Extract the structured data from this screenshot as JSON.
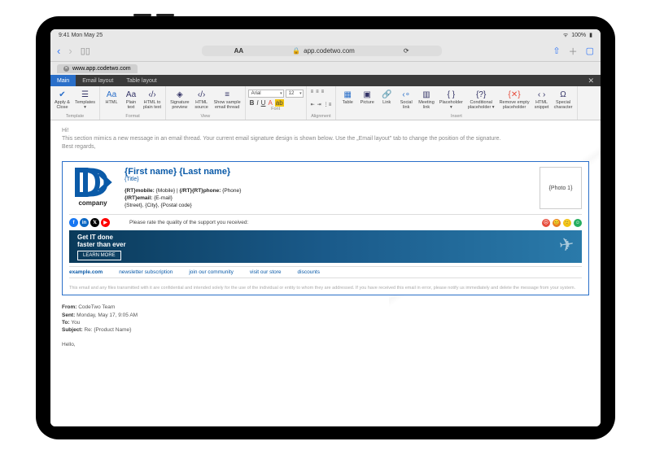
{
  "status": {
    "time": "9:41 Mon May 25",
    "battery": "100%"
  },
  "browser": {
    "aa": "AA",
    "lock": "🔒",
    "url": "app.codetwo.com",
    "tab_url": "www.app.codetwo.com"
  },
  "ribbon": {
    "tabs": [
      "Main",
      "Email layout",
      "Table layout"
    ],
    "groups": {
      "template": {
        "label": "Template",
        "apply_close": "Apply &\nClose",
        "templates": "Templates\n▾"
      },
      "format": {
        "label": "Format",
        "html": "HTML",
        "plain": "Plain\ntext",
        "html2plain": "HTML to\nplain text"
      },
      "view": {
        "label": "View",
        "sig_preview": "Signature\npreview",
        "html_src": "HTML\nsource",
        "sample": "Show sample\nemail thread"
      },
      "font": {
        "label": "Font",
        "name": "Arial",
        "size": "12"
      },
      "alignment": {
        "label": "Alignment"
      },
      "insert": {
        "label": "Insert",
        "table": "Table",
        "picture": "Picture",
        "link": "Link",
        "social": "Social\nlink",
        "meeting": "Meeting\nlink",
        "placeholder": "Placeholder\n▾",
        "cond": "Conditional\nplaceholder ▾",
        "remove": "Remove empty\nplaceholder",
        "snippet": "HTML\nsnippet",
        "special": "Special\ncharacter"
      }
    }
  },
  "content": {
    "greeting": "Hi!",
    "intro": "This section mimics a new message in an email thread. Your current email signature design is shown below. Use the „Email layout\" tab to change the position of the signature.",
    "regards": "Best regards,"
  },
  "signature": {
    "logo_text": "company",
    "name": "{First name} {Last name}",
    "title": "{Title}",
    "contact_line1_a": "{RT}mobile:",
    "contact_line1_b": " {Mobile}   |   ",
    "contact_line1_c": "{/RT}{RT}phone:",
    "contact_line1_d": " {Phone}",
    "contact_line2_a": "{/RT}email:",
    "contact_line2_b": " {E-mail}",
    "contact_line3": "{Street}, {City}, {Postal code}",
    "photo": "{Photo 1}",
    "rate_text": "Please rate the quality of the support you received:",
    "banner_line1": "Get IT done",
    "banner_line2": "faster than ever",
    "banner_cta": "LEARN MORE",
    "links": [
      "example.com",
      "newsletter subscription",
      "join our community",
      "visit our store",
      "discounts"
    ],
    "disclaimer": "This email and any files transmitted with it are confidential and intended solely for the use of the individual or entity to whom they are addressed. If you have received this email in error, please notify us immediately and delete the message from your system."
  },
  "thread": {
    "from_lbl": "From:",
    "from": "CodeTwo Team",
    "sent_lbl": "Sent:",
    "sent": "Monday, May 17, 9:05 AM",
    "to_lbl": "To:",
    "to": "You",
    "subject_lbl": "Subject:",
    "subject": "Re: {Product Name}",
    "hello": "Hello,"
  }
}
